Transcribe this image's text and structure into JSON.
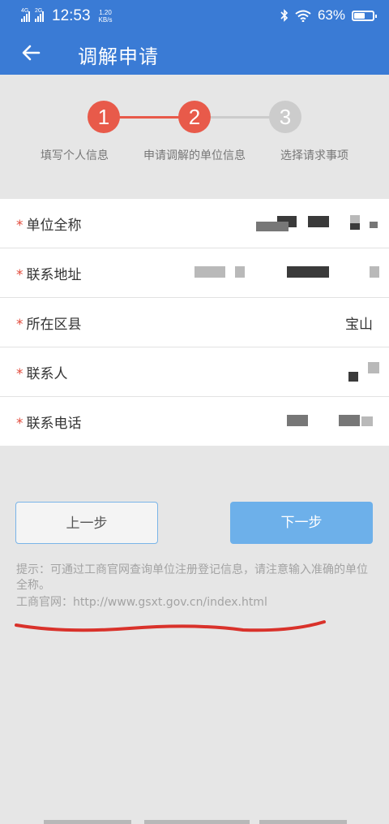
{
  "status_bar": {
    "signal1": "4G",
    "signal2": "2G",
    "time": "12:53",
    "speed_value": "1.20",
    "speed_unit": "KB/s",
    "battery": "63%",
    "battery_level": 0.63
  },
  "app_bar": {
    "title": "调解申请"
  },
  "stepper": {
    "steps": [
      {
        "number": "1",
        "label": "填写个人信息",
        "state": "done"
      },
      {
        "number": "2",
        "label": "申请调解的单位信息",
        "state": "active"
      },
      {
        "number": "3",
        "label": "选择请求事项",
        "state": "pending"
      }
    ],
    "colors": {
      "active": "#e85a4a",
      "inactive": "#cccccc"
    }
  },
  "form": {
    "required_mark": "*",
    "fields": [
      {
        "label": "单位全称",
        "value": ""
      },
      {
        "label": "联系地址",
        "value": ""
      },
      {
        "label": "所在区县",
        "value": "宝山"
      },
      {
        "label": "联系人",
        "value": ""
      },
      {
        "label": "联系电话",
        "value": ""
      }
    ]
  },
  "buttons": {
    "prev": "上一步",
    "next": "下一步"
  },
  "hint": {
    "text": "提示：可通过工商官网查询单位注册登记信息，请注意输入准确的单位全称。",
    "url_line": "工商官网：http://www.gsxt.gov.cn/index.html"
  },
  "colors": {
    "primary": "#3a7bd5",
    "accent": "#e85a4a",
    "button_blue": "#6db0ea",
    "annotation_red": "#d9322b"
  }
}
